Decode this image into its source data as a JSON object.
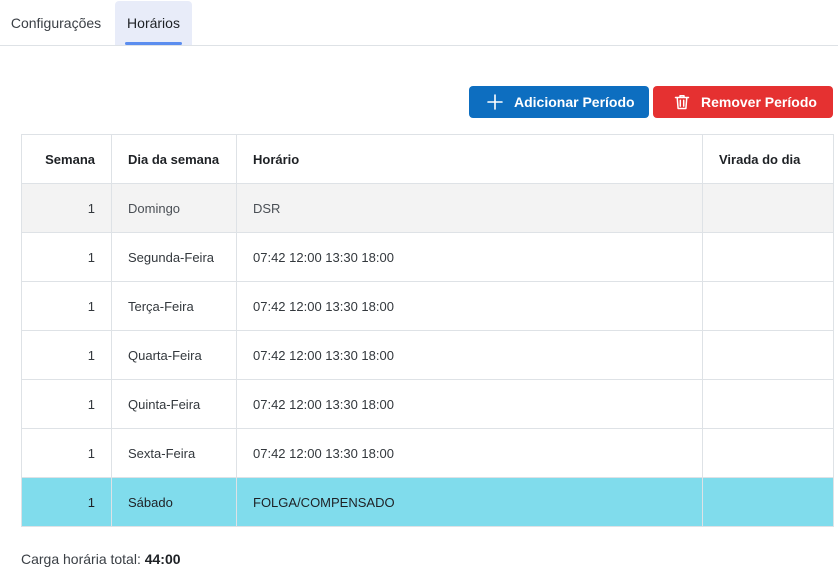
{
  "tabs": [
    {
      "label": "Configurações",
      "active": false
    },
    {
      "label": "Horários",
      "active": true
    }
  ],
  "toolbar": {
    "add_label": "Adicionar Período",
    "add_icon": "plus-icon",
    "add_color": "#0d6ec0",
    "remove_label": "Remover Período",
    "remove_icon": "trash-icon",
    "remove_color": "#e53131"
  },
  "table": {
    "headers": [
      "Semana",
      "Dia da semana",
      "Horário",
      "Virada do dia"
    ],
    "rows": [
      {
        "semana": "1",
        "dia": "Domingo",
        "horario": "DSR",
        "virada": "",
        "style": "gray"
      },
      {
        "semana": "1",
        "dia": "Segunda-Feira",
        "horario": "07:42 12:00 13:30 18:00",
        "virada": "",
        "style": "normal"
      },
      {
        "semana": "1",
        "dia": "Terça-Feira",
        "horario": "07:42 12:00 13:30 18:00",
        "virada": "",
        "style": "normal"
      },
      {
        "semana": "1",
        "dia": "Quarta-Feira",
        "horario": "07:42 12:00 13:30 18:00",
        "virada": "",
        "style": "normal"
      },
      {
        "semana": "1",
        "dia": "Quinta-Feira",
        "horario": "07:42 12:00 13:30 18:00",
        "virada": "",
        "style": "normal"
      },
      {
        "semana": "1",
        "dia": "Sexta-Feira",
        "horario": "07:42 12:00 13:30 18:00",
        "virada": "",
        "style": "normal"
      },
      {
        "semana": "1",
        "dia": "Sábado",
        "horario": "FOLGA/COMPENSADO",
        "virada": "",
        "style": "selected"
      }
    ],
    "row_colors": {
      "gray": "#f3f3f3",
      "selected": "#80dcec"
    }
  },
  "summary": {
    "label": "Carga horária total:",
    "value": "44:00"
  }
}
